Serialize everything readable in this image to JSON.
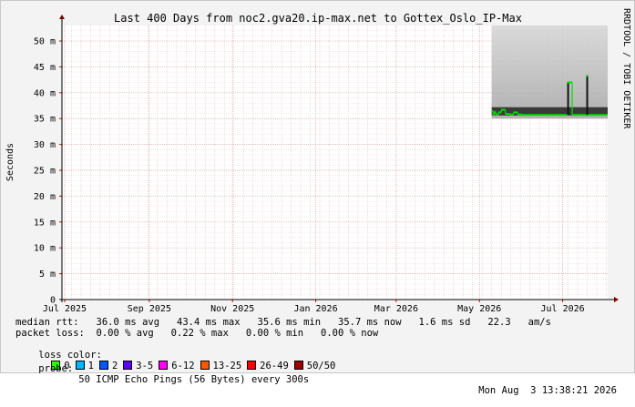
{
  "watermark": "RRDTOOL / TOBI OETIKER",
  "chart_data": {
    "type": "line",
    "title": "Last 400 Days from noc2.gva20.ip-max.net to Gottex_Oslo_IP-Max",
    "ylabel": "Seconds",
    "xlabel": "",
    "ylim": [
      0,
      0.053
    ],
    "y_tick_values": [
      0,
      0.005,
      0.01,
      0.015,
      0.02,
      0.025,
      0.03,
      0.035,
      0.04,
      0.045,
      0.05
    ],
    "y_tick_labels": [
      "0",
      "5 m",
      "10 m",
      "15 m",
      "20 m",
      "25 m",
      "30 m",
      "35 m",
      "40 m",
      "45 m",
      "50 m"
    ],
    "x_tick_labels": [
      "Jul 2025",
      "Sep 2025",
      "Nov 2025",
      "Jan 2026",
      "Mar 2026",
      "May 2026",
      "Jul 2026"
    ],
    "xlim": [
      "2025-06-29",
      "2026-08-03"
    ],
    "x_ticks": [
      "2025-07-01",
      "2025-09-01",
      "2025-11-01",
      "2026-01-01",
      "2026-03-01",
      "2026-05-01",
      "2026-07-01"
    ],
    "grid": true,
    "series": [
      {
        "name": "median rtt",
        "color": "#00e000",
        "x": [
          "2026-05-10",
          "2026-05-11",
          "2026-05-12",
          "2026-05-13",
          "2026-05-15",
          "2026-05-17",
          "2026-05-20",
          "2026-05-23",
          "2026-05-26",
          "2026-05-29",
          "2026-06-01",
          "2026-06-05",
          "2026-06-10",
          "2026-06-15",
          "2026-06-20",
          "2026-06-25",
          "2026-06-30",
          "2026-07-02",
          "2026-07-05",
          "2026-07-08",
          "2026-07-10",
          "2026-07-15",
          "2026-07-20",
          "2026-07-25",
          "2026-08-01",
          "2026-08-03"
        ],
        "values": [
          0.0365,
          0.0358,
          0.0363,
          0.0358,
          0.0362,
          0.0367,
          0.0359,
          0.0358,
          0.0362,
          0.0358,
          0.0357,
          0.0357,
          0.0357,
          0.0357,
          0.0357,
          0.0357,
          0.0357,
          0.0357,
          0.042,
          0.0357,
          0.0357,
          0.0357,
          0.0357,
          0.0357,
          0.0357,
          0.0357
        ]
      }
    ],
    "spikes": [
      {
        "x": "2026-07-05",
        "value": 0.042
      },
      {
        "x": "2026-07-19",
        "value": 0.0433
      }
    ],
    "smoke_range": {
      "x_start": "2026-05-10",
      "x_end": "2026-08-03",
      "low": 0.035,
      "high": 0.053
    }
  },
  "legend": {
    "median_rtt_line": "median rtt:   36.0 ms avg   43.4 ms max   35.6 ms min   35.7 ms now   1.6 ms sd   22.3   am/s",
    "packet_loss_line": "packet loss:  0.00 % avg   0.22 % max   0.00 % min   0.00 % now",
    "loss_color_label": "loss color:",
    "loss_colors": [
      {
        "label": "0",
        "color": "#26ff00"
      },
      {
        "label": "1",
        "color": "#00b8ff"
      },
      {
        "label": "2",
        "color": "#0059ff"
      },
      {
        "label": "3-5",
        "color": "#5e00ff"
      },
      {
        "label": "6-12",
        "color": "#ff00ff"
      },
      {
        "label": "13-25",
        "color": "#ff5500"
      },
      {
        "label": "26-49",
        "color": "#ff0000"
      },
      {
        "label": "50/50",
        "color": "#a00000"
      }
    ],
    "probe_label": "probe:",
    "probe_value": "50 ICMP Echo Pings (56 Bytes) every 300s",
    "timestamp": "Mon Aug  3 13:38:21 2026"
  }
}
